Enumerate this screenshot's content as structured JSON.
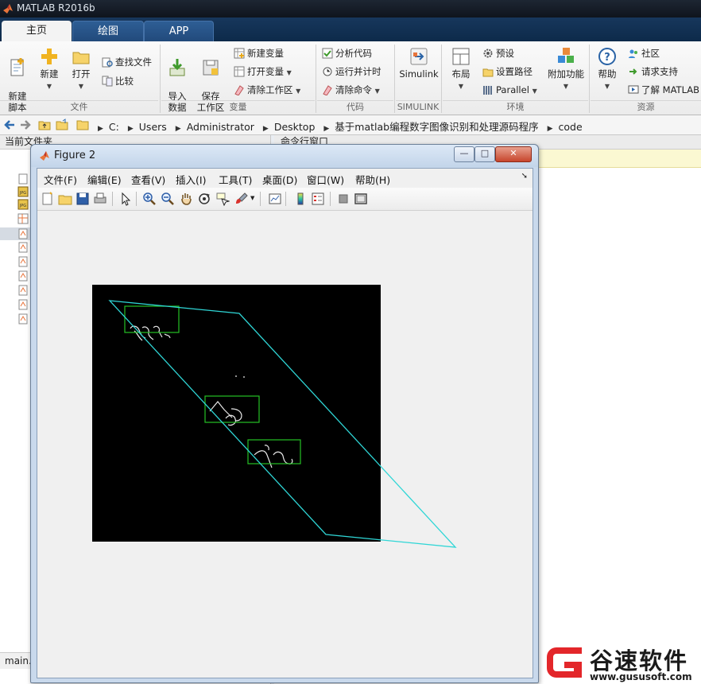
{
  "app": {
    "title": "MATLAB R2016b"
  },
  "tabs": [
    {
      "label": "主页",
      "active": true
    },
    {
      "label": "绘图",
      "active": false
    },
    {
      "label": "APP",
      "active": false
    }
  ],
  "ribbon": {
    "file": {
      "group_label": "文件",
      "new_script": "新建\n脚本",
      "new": "新建",
      "open": "打开",
      "find_files": "查找文件",
      "compare": "比较"
    },
    "variable": {
      "group_label": "变量",
      "import_data": "导入\n数据",
      "save_workspace": "保存\n工作区",
      "new_variable": "新建变量",
      "open_variable": "打开变量",
      "clear_workspace": "清除工作区"
    },
    "code": {
      "group_label": "代码",
      "analyze_code": "分析代码",
      "run_and_time": "运行并计时",
      "clear_commands": "清除命令"
    },
    "simulink": {
      "group_label": "SIMULINK",
      "simulink": "Simulink"
    },
    "environment": {
      "group_label": "环境",
      "layout": "布局",
      "preferences": "预设",
      "set_path": "设置路径",
      "parallel": "Parallel",
      "add_ons": "附加功能"
    },
    "resources": {
      "group_label": "资源",
      "help": "帮助",
      "community": "社区",
      "request_support": "请求支持",
      "learn_matlab": "了解 MATLAB"
    }
  },
  "address": {
    "path": [
      "C:",
      "Users",
      "Administrator",
      "Desktop",
      "基于matlab编程数字图像识别和处理源码程序",
      "code"
    ]
  },
  "panels": {
    "current_folder": "当前文件夹",
    "command_window": "命令行窗口",
    "main_file": "main."
  },
  "figure": {
    "title": "Figure 2",
    "menus": [
      "文件(F)",
      "编辑(E)",
      "查看(V)",
      "插入(I)",
      "工具(T)",
      "桌面(D)",
      "窗口(W)",
      "帮助(H)"
    ],
    "toolbar_icons": [
      "new-figure-icon",
      "open-file-icon",
      "save-icon",
      "print-icon",
      "pointer-icon",
      "zoom-in-icon",
      "zoom-out-icon",
      "pan-hand-icon",
      "rotate-3d-icon",
      "data-cursor-icon",
      "brush-icon",
      "link-plot-icon",
      "colorbar-icon",
      "legend-icon",
      "hide-plot-tools-icon",
      "show-plot-tools-icon"
    ],
    "colors": {
      "boxes": "#25c125",
      "quad": "#2fd6d6",
      "axes_bg": "#000000"
    }
  },
  "watermark": {
    "brand": "谷速软件",
    "url": "www.gususoft.com",
    "color": "#e3262a"
  }
}
